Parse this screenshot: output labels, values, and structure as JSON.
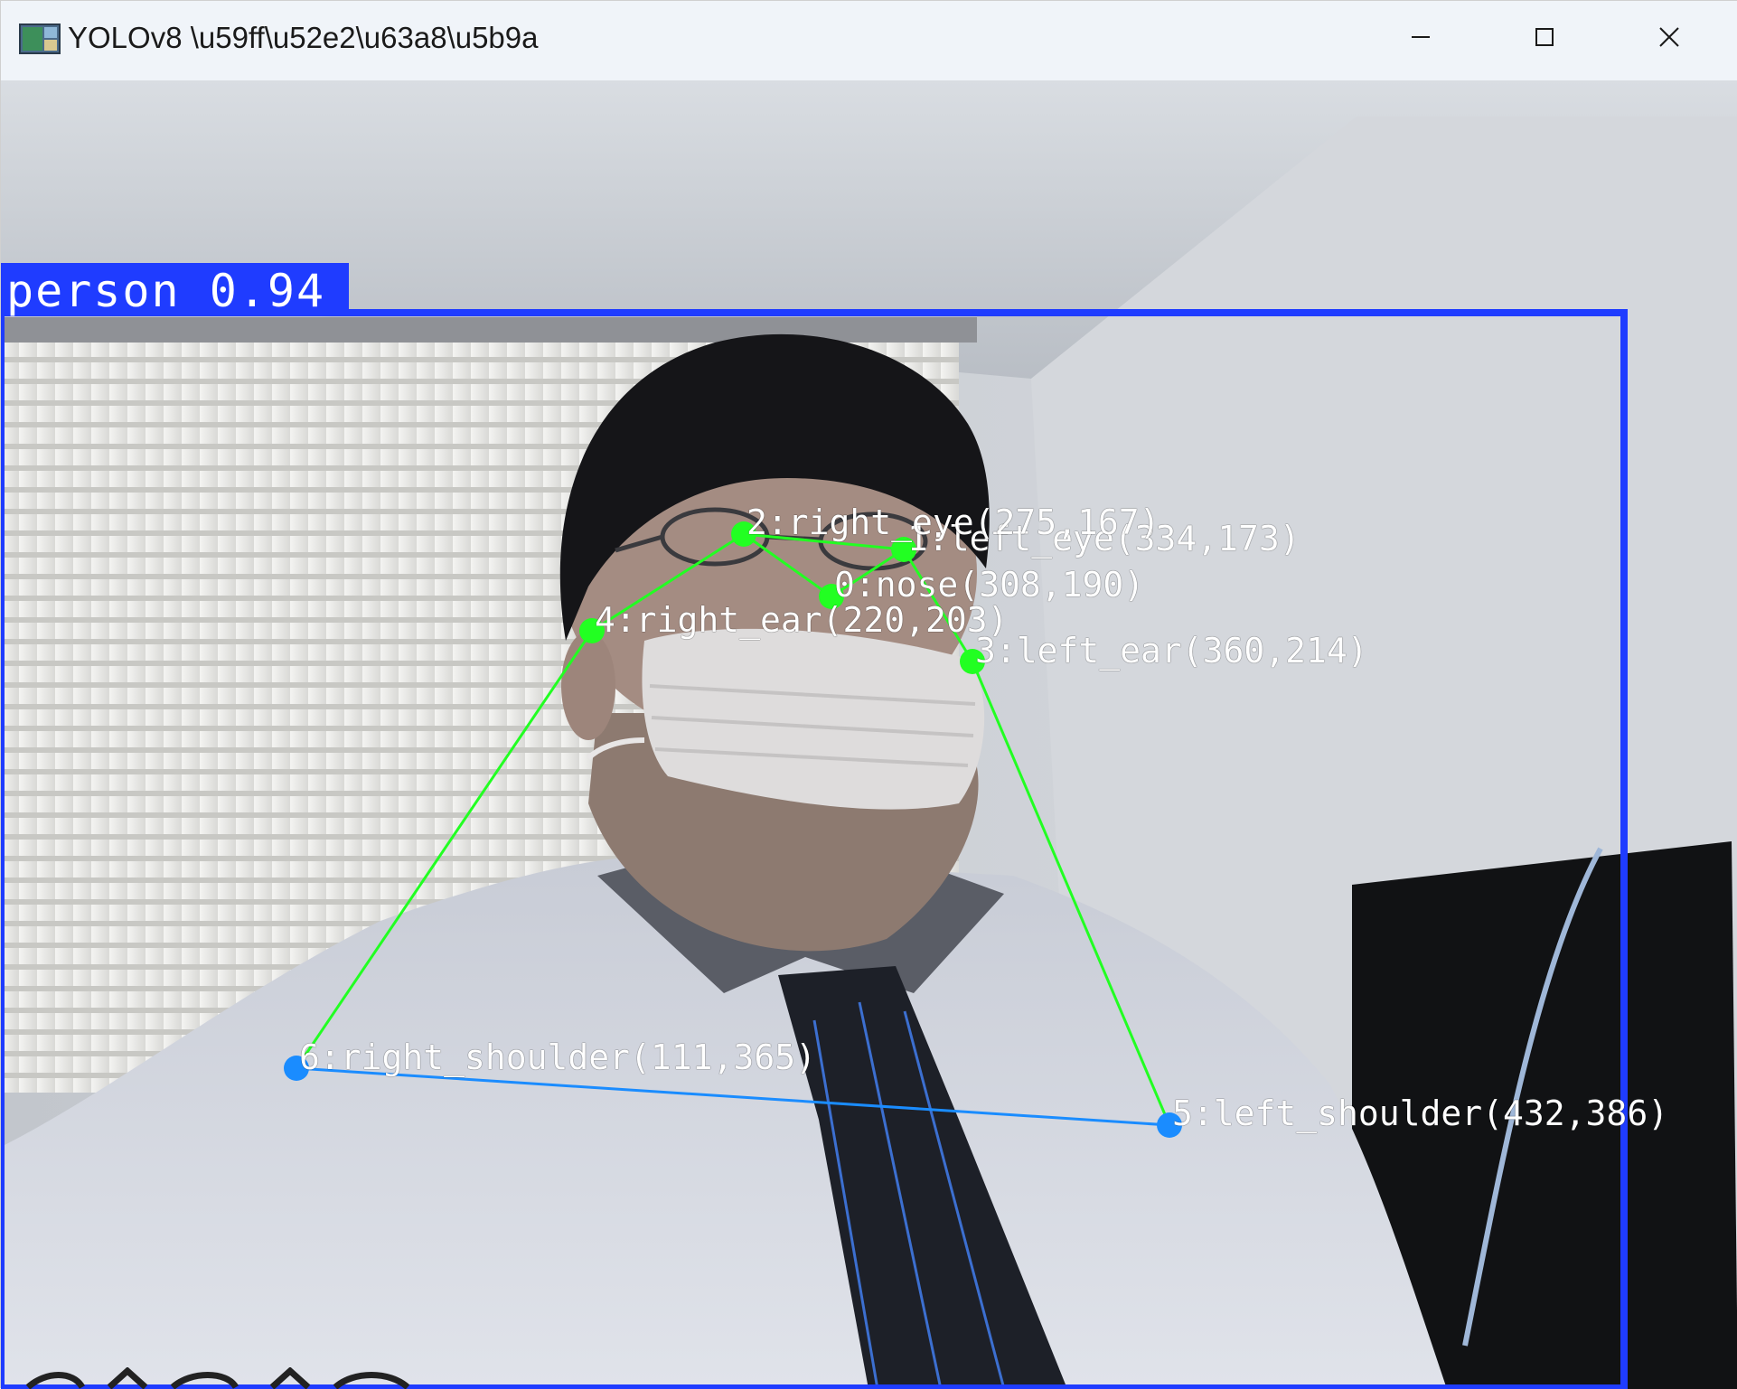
{
  "window": {
    "title": "YOLOv8 \\u59ff\\u52e2\\u63a8\\u5b9a",
    "app_icon": "opencv-window-icon",
    "controls": {
      "minimize_icon": "minimize-icon",
      "maximize_icon": "maximize-icon",
      "close_icon": "close-icon"
    }
  },
  "detection": {
    "label": "person 0.94",
    "box_color": "#1f3cff",
    "skeleton_color_head": "#22ff22",
    "skeleton_color_shoulders": "#1a8cff",
    "keypoints": [
      {
        "id": 0,
        "text": "0:nose(308,190)"
      },
      {
        "id": 1,
        "text": "1:left_eye(334,173)"
      },
      {
        "id": 2,
        "text": "2:right_eye(275,167)"
      },
      {
        "id": 3,
        "text": "3:left_ear(360,214)"
      },
      {
        "id": 4,
        "text": "4:right_ear(220,203)"
      },
      {
        "id": 5,
        "text": "5:left_shoulder(432,386)"
      },
      {
        "id": 6,
        "text": "6:right_shoulder(111,365)"
      }
    ]
  }
}
